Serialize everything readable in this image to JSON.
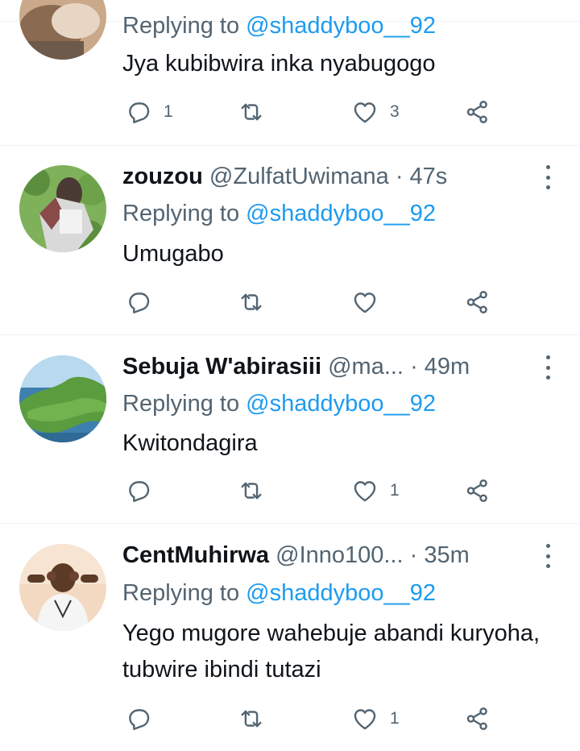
{
  "tweets": [
    {
      "name": "",
      "handle": "",
      "time": "",
      "replying_prefix": "Replying to ",
      "replying_handle": "@shaddyboo__92",
      "text": "Jya kubibwira inka nyabugogo",
      "reply_count": "1",
      "retweet_count": "",
      "like_count": "3"
    },
    {
      "name": "zouzou",
      "handle": "@ZulfatUwimana",
      "time": "· 47s",
      "replying_prefix": "Replying to ",
      "replying_handle": "@shaddyboo__92",
      "text": "Umugabo",
      "reply_count": "",
      "retweet_count": "",
      "like_count": ""
    },
    {
      "name": "Sebuja W'abirasiii",
      "handle": "@ma...",
      "time": "· 49m",
      "replying_prefix": "Replying to ",
      "replying_handle": "@shaddyboo__92",
      "text": "Kwitondagira",
      "reply_count": "",
      "retweet_count": "",
      "like_count": "1"
    },
    {
      "name": "CentMuhirwa",
      "handle": "@Inno100...",
      "time": "· 35m",
      "replying_prefix": "Replying to ",
      "replying_handle": "@shaddyboo__92",
      "text": "Yego mugore wahebuje abandi kuryoha, tubwire ibindi tutazi",
      "reply_count": "",
      "retweet_count": "",
      "like_count": "1"
    }
  ],
  "colors": {
    "link": "#1d9bf0",
    "muted": "#536471",
    "text": "#0f1419",
    "divider": "#eff3f4"
  },
  "icons": [
    "reply-icon",
    "retweet-icon",
    "like-icon",
    "share-icon",
    "more-icon"
  ]
}
